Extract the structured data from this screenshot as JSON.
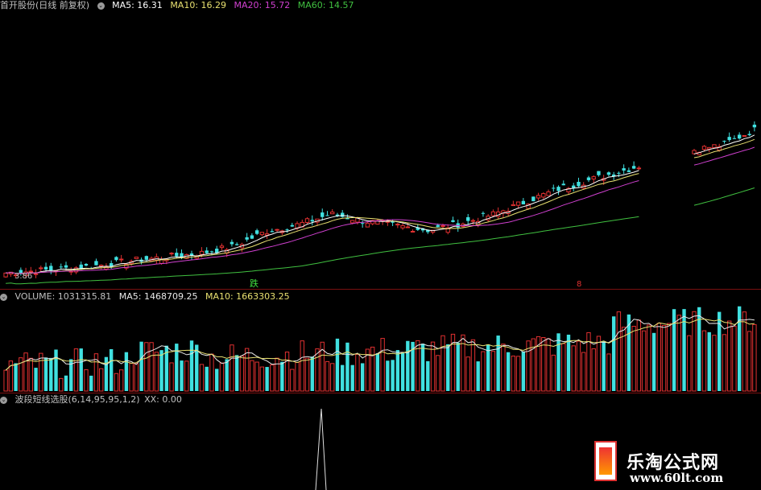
{
  "main_panel": {
    "title": "首开股份(日线 前复权)",
    "indicators": [
      {
        "label": "MA5: 16.31",
        "color": "#ffffff"
      },
      {
        "label": "MA10: 16.29",
        "color": "#e8e070"
      },
      {
        "label": "MA20: 15.72",
        "color": "#d040d0"
      },
      {
        "label": "MA60: 14.57",
        "color": "#40c040"
      }
    ],
    "low_price_label": "3.86",
    "marker_left": "跌",
    "marker_right": "8"
  },
  "volume_panel": {
    "indicators": [
      {
        "label": "VOLUME: 1031315.81",
        "color": "#c0c0c0"
      },
      {
        "label": "MA5: 1468709.25",
        "color": "#e8e8e8"
      },
      {
        "label": "MA10: 1663303.25",
        "color": "#e8e070"
      }
    ]
  },
  "signal_panel": {
    "title": "波段短线选股(6,14,95,95,1,2)",
    "indicator": "XX: 0.00"
  },
  "watermark": {
    "title": "乐淘公式网",
    "url": "www.60lt.com"
  },
  "colors": {
    "up": "#e03030",
    "down": "#40e0e0",
    "ma5": "#ffffff",
    "ma10": "#e8e070",
    "ma20": "#d040d0",
    "ma60": "#40c040",
    "separator": "#7a1010"
  },
  "chart_data": [
    {
      "type": "candlestick",
      "title": "首开股份(日线 前复权)",
      "series": [
        {
          "name": "MA5",
          "value": 16.31
        },
        {
          "name": "MA10",
          "value": 16.29
        },
        {
          "name": "MA20",
          "value": 15.72
        },
        {
          "name": "MA60",
          "value": 14.57
        }
      ],
      "price_trend": [
        3.9,
        4.1,
        4.3,
        4.6,
        5.0,
        5.3,
        5.6,
        6.2,
        7.5,
        8.1,
        9.0,
        8.4,
        8.0,
        7.6,
        8.2,
        9.0,
        10.1,
        11.2,
        12.0,
        12.8,
        13.6,
        14.5,
        15.0,
        16.3
      ]
    },
    {
      "type": "bar",
      "title": "VOLUME",
      "series": [
        {
          "name": "VOLUME",
          "value": 1031315.81
        },
        {
          "name": "MA5",
          "value": 1468709.25
        },
        {
          "name": "MA10",
          "value": 1663303.25
        }
      ]
    },
    {
      "type": "line",
      "title": "波段短线选股(6,14,95,95,1,2)",
      "series": [
        {
          "name": "XX",
          "value": 0.0
        }
      ]
    }
  ]
}
